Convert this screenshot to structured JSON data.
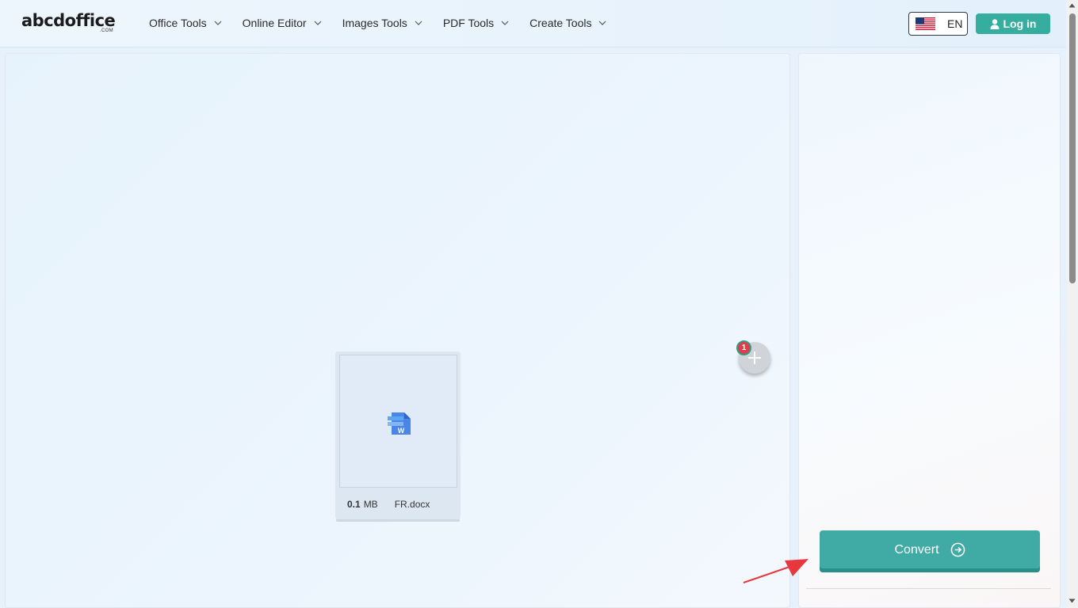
{
  "brand": {
    "logo_text": "abcdoffice",
    "logo_sub": ".COM"
  },
  "nav": {
    "items": [
      {
        "label": "Office Tools"
      },
      {
        "label": "Online Editor"
      },
      {
        "label": "Images Tools"
      },
      {
        "label": "PDF Tools"
      },
      {
        "label": "Create Tools"
      }
    ]
  },
  "language": {
    "label": "EN",
    "flag_icon": "us-flag-icon"
  },
  "auth": {
    "login_label": "Log in",
    "icon": "user-icon"
  },
  "file": {
    "size_value": "0.1",
    "size_unit": "MB",
    "name": "FR.docx",
    "icon": "word-document-icon"
  },
  "add_files": {
    "badge_count": "1",
    "icon": "plus-icon"
  },
  "convert": {
    "label": "Convert",
    "icon": "arrow-right-circle-icon"
  },
  "colors": {
    "accent": "#35aea0",
    "convert_bg": "#40aba4",
    "badge_bg": "#e23c4a",
    "annotation_arrow": "#e8383d"
  }
}
